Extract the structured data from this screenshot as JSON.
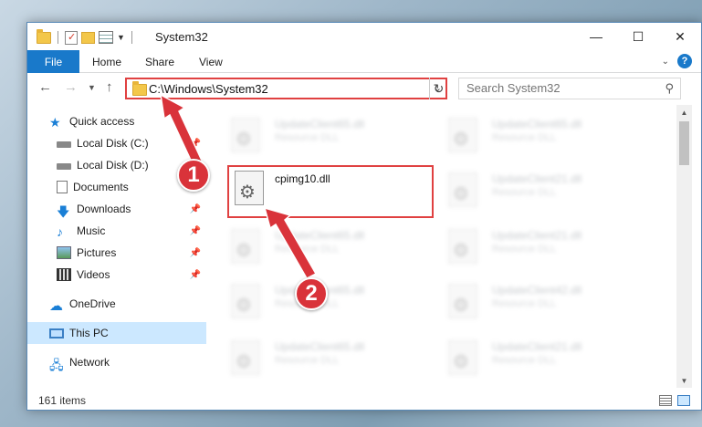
{
  "window": {
    "title": "System32",
    "controls": {
      "minimize": "—",
      "maximize": "☐",
      "close": "✕"
    }
  },
  "ribbon": {
    "tabs": [
      "File",
      "Home",
      "Share",
      "View"
    ],
    "help": "?"
  },
  "nav": {
    "address": "C:\\Windows\\System32",
    "search_placeholder": "Search System32"
  },
  "sidebar": {
    "items": [
      {
        "label": "Quick access",
        "icon": "star-icon",
        "pinned": false
      },
      {
        "label": "Local Disk (C:)",
        "icon": "drive-icon",
        "pinned": true
      },
      {
        "label": "Local Disk (D:)",
        "icon": "drive-icon",
        "pinned": false
      },
      {
        "label": "Documents",
        "icon": "document-icon",
        "pinned": false
      },
      {
        "label": "Downloads",
        "icon": "download-icon",
        "pinned": true
      },
      {
        "label": "Music",
        "icon": "music-icon",
        "pinned": true
      },
      {
        "label": "Pictures",
        "icon": "pictures-icon",
        "pinned": true
      },
      {
        "label": "Videos",
        "icon": "video-icon",
        "pinned": true
      },
      {
        "label": "OneDrive",
        "icon": "cloud-icon",
        "pinned": false
      },
      {
        "label": "This PC",
        "icon": "computer-icon",
        "pinned": false,
        "selected": true
      },
      {
        "label": "Network",
        "icon": "network-icon",
        "pinned": false
      }
    ]
  },
  "files": {
    "left": [
      {
        "name": "UpdateClient65.dll",
        "type": "Resource DLL"
      },
      {
        "name": "cpimg10.dll",
        "type": "",
        "highlighted": true
      },
      {
        "name": "UpdateClient65.dll",
        "type": "Resource DLL"
      },
      {
        "name": "UpdateClient65.dll",
        "type": "Resource DLL"
      },
      {
        "name": "UpdateClient65.dll",
        "type": "Resource DLL"
      }
    ],
    "right": [
      {
        "name": "UpdateClient65.dll",
        "type": "Resource DLL"
      },
      {
        "name": "UpdateClient21.dll",
        "type": "Resource DLL"
      },
      {
        "name": "UpdateClient21.dll",
        "type": "Resource DLL"
      },
      {
        "name": "UpdateClient42.dll",
        "type": "Resource DLL"
      },
      {
        "name": "UpdateClient21.dll",
        "type": "Resource DLL"
      }
    ]
  },
  "status": {
    "items": "161 items"
  },
  "annotations": {
    "step1": "1",
    "step2": "2",
    "color": "#d9333a"
  }
}
